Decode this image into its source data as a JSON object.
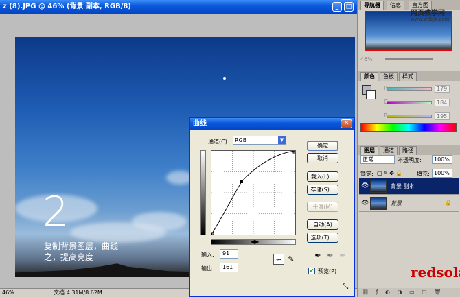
{
  "document": {
    "title": "z (8).JPG @ 46% (背景 副本, RGB/8)",
    "big_number": "2",
    "caption_line1": "复制背景图层，曲线",
    "caption_line2": "之，提高亮度",
    "status_zoom": "46%",
    "status_doc": "文档:4.31M/8.62M"
  },
  "navigator": {
    "tabs": [
      "导航器",
      "信息",
      "直方图"
    ],
    "zoom": "46%"
  },
  "color": {
    "tabs": [
      "颜色",
      "色板",
      "样式"
    ],
    "channels": [
      {
        "label": "R",
        "value": "179",
        "color": "#c03030"
      },
      {
        "label": "G",
        "value": "184",
        "color": "#30a030"
      },
      {
        "label": "B",
        "value": "195",
        "color": "#3030c0"
      }
    ]
  },
  "layers": {
    "tabs": [
      "图层",
      "通道",
      "路径"
    ],
    "blend_mode": "正常",
    "opacity_label": "不透明度:",
    "opacity_value": "100%",
    "lock_label": "锁定:",
    "fill_label": "填充:",
    "fill_value": "100%",
    "items": [
      {
        "name": "背景 副本",
        "selected": true
      },
      {
        "name": "背景",
        "selected": false
      }
    ]
  },
  "curves_dialog": {
    "title": "曲线",
    "channel_label": "通道(C):",
    "channel_value": "RGB",
    "buttons": {
      "ok": "确定",
      "cancel": "取消",
      "load": "载入(L)...",
      "save": "存储(S)...",
      "smooth": "平滑(M)",
      "auto": "自动(A)",
      "options": "选项(T)..."
    },
    "input_label": "输入:",
    "input_value": "91",
    "output_label": "输出:",
    "output_value": "161",
    "preview_label": "预览(P)",
    "preview_checked": true
  },
  "watermark": {
    "site": "网页教学网",
    "url": "www.webjx.com",
    "logo": "redsola"
  }
}
